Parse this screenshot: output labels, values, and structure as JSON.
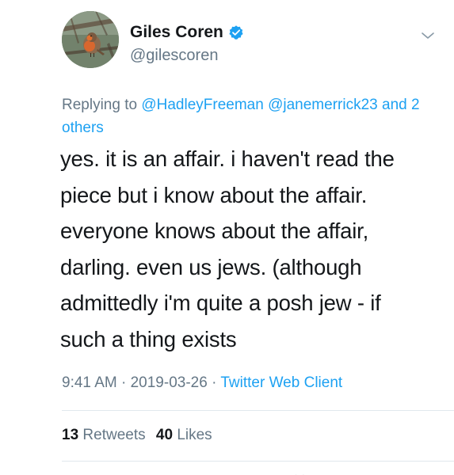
{
  "tweet": {
    "author": {
      "display_name": "Giles Coren",
      "handle": "@gilescoren",
      "verified": true
    },
    "reply": {
      "prefix": "Replying to",
      "mentions": [
        "@HadleyFreeman",
        "@janemerrick23"
      ],
      "others": "and 2 others"
    },
    "text": "yes. it is an affair. i haven't read the\npiece but i know about the affair.\neveryone knows about the affair,\ndarling. even us jews. (although\nadmittedly i'm quite a posh jew - if\nsuch a thing exists",
    "time": "9:41 AM",
    "separator": "·",
    "date": "2019-03-26",
    "client": "Twitter Web Client",
    "stats": {
      "retweets_count": "13",
      "retweets_label": "Retweets",
      "likes_count": "40",
      "likes_label": "Likes"
    }
  },
  "icons": {
    "verified": "verified-badge-icon",
    "caret": "chevron-down-icon"
  },
  "colors": {
    "link": "#1da1f2",
    "secondary_text": "#657786",
    "primary_text": "#14171a",
    "divider": "#e1e8ed"
  }
}
